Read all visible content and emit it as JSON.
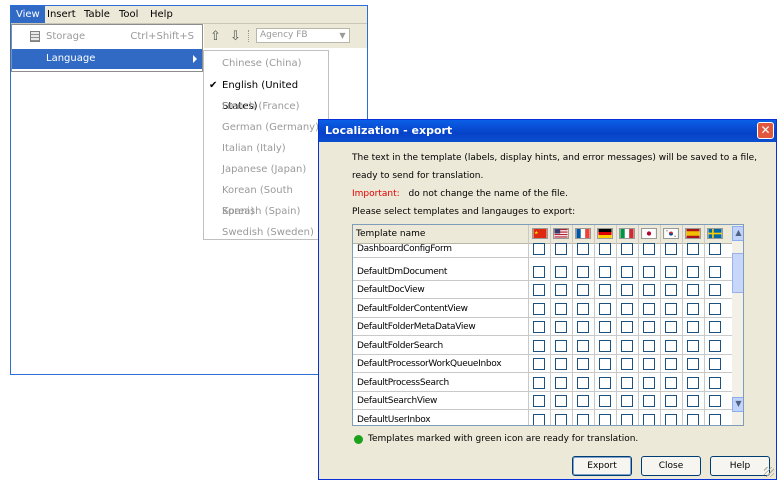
{
  "menubar": {
    "items": [
      "View",
      "Insert",
      "Table",
      "Tool",
      "Help"
    ],
    "active": "View"
  },
  "view_menu": {
    "storage": {
      "label": "Storage",
      "shortcut": "Ctrl+Shift+S",
      "icon": "storage-icon"
    },
    "language": {
      "label": "Language"
    }
  },
  "toolbar": {
    "up_icon": "arrow-up-icon",
    "down_icon": "arrow-down-icon",
    "font_combo": "Agency FB"
  },
  "language_menu": {
    "items": [
      "Chinese (China)",
      "English (United States)",
      "French (France)",
      "German (Germany)",
      "Italian (Italy)",
      "Japanese (Japan)",
      "Korean (South Korea)",
      "Spanish (Spain)",
      "Swedish (Sweden)"
    ],
    "checked": "English (United States)"
  },
  "dialog": {
    "title": "Localization - export",
    "line1": "The text in the template (labels, display hints, and error messages) will be saved to a file,",
    "line2": "ready to send for translation.",
    "important_label": "Important:",
    "important_text": "do not change the name of the file.",
    "line4": "Please select templates and langauges to export:",
    "table": {
      "header": "Template name",
      "flags": [
        "china-flag-icon",
        "usa-flag-icon",
        "france-flag-icon",
        "germany-flag-icon",
        "italy-flag-icon",
        "japan-flag-icon",
        "korea-flag-icon",
        "spain-flag-icon",
        "sweden-flag-icon"
      ],
      "rows": [
        "DashboardConfigForm",
        "DefaultDmDocument",
        "DefaultDocView",
        "DefaultFolderContentView",
        "DefaultFolderMetaDataView",
        "DefaultFolderSearch",
        "DefaultProcessorWorkQueueInbox",
        "DefaultProcessSearch",
        "DefaultSearchView",
        "DefaultUserInbox"
      ]
    },
    "note": "Templates marked with green icon are ready for translation.",
    "buttons": {
      "export": "Export",
      "close": "Close",
      "help": "Help"
    }
  },
  "colors": {
    "selection": "#316ac5",
    "titlebar": "#0642c8",
    "ready": "#1aa31a",
    "important": "#e00000"
  }
}
